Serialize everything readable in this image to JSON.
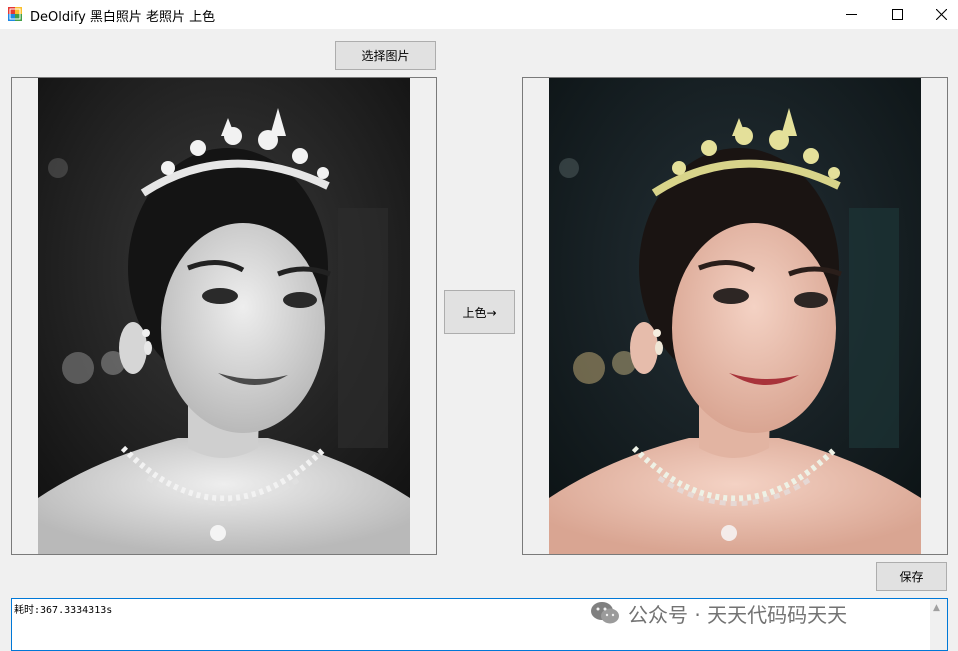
{
  "window": {
    "title": "DeOldify 黑白照片 老照片 上色"
  },
  "buttons": {
    "select_image": "选择图片",
    "colorize": "上色→",
    "save": "保存"
  },
  "images": {
    "source_alt": "黑白照片",
    "result_alt": "上色结果"
  },
  "log": {
    "text": "耗时:367.3334313s"
  },
  "watermark": {
    "text": "公众号 · 天天代码码天天"
  },
  "icons": {
    "app": "app-icon",
    "minimize": "minimize-icon",
    "maximize": "maximize-icon",
    "close": "close-icon",
    "wechat": "wechat-icon",
    "scroll_up": "chevron-up-icon"
  },
  "colors": {
    "accent_border": "#0078d7",
    "button_face": "#e1e1e1",
    "window_bg": "#f0f0f0"
  }
}
